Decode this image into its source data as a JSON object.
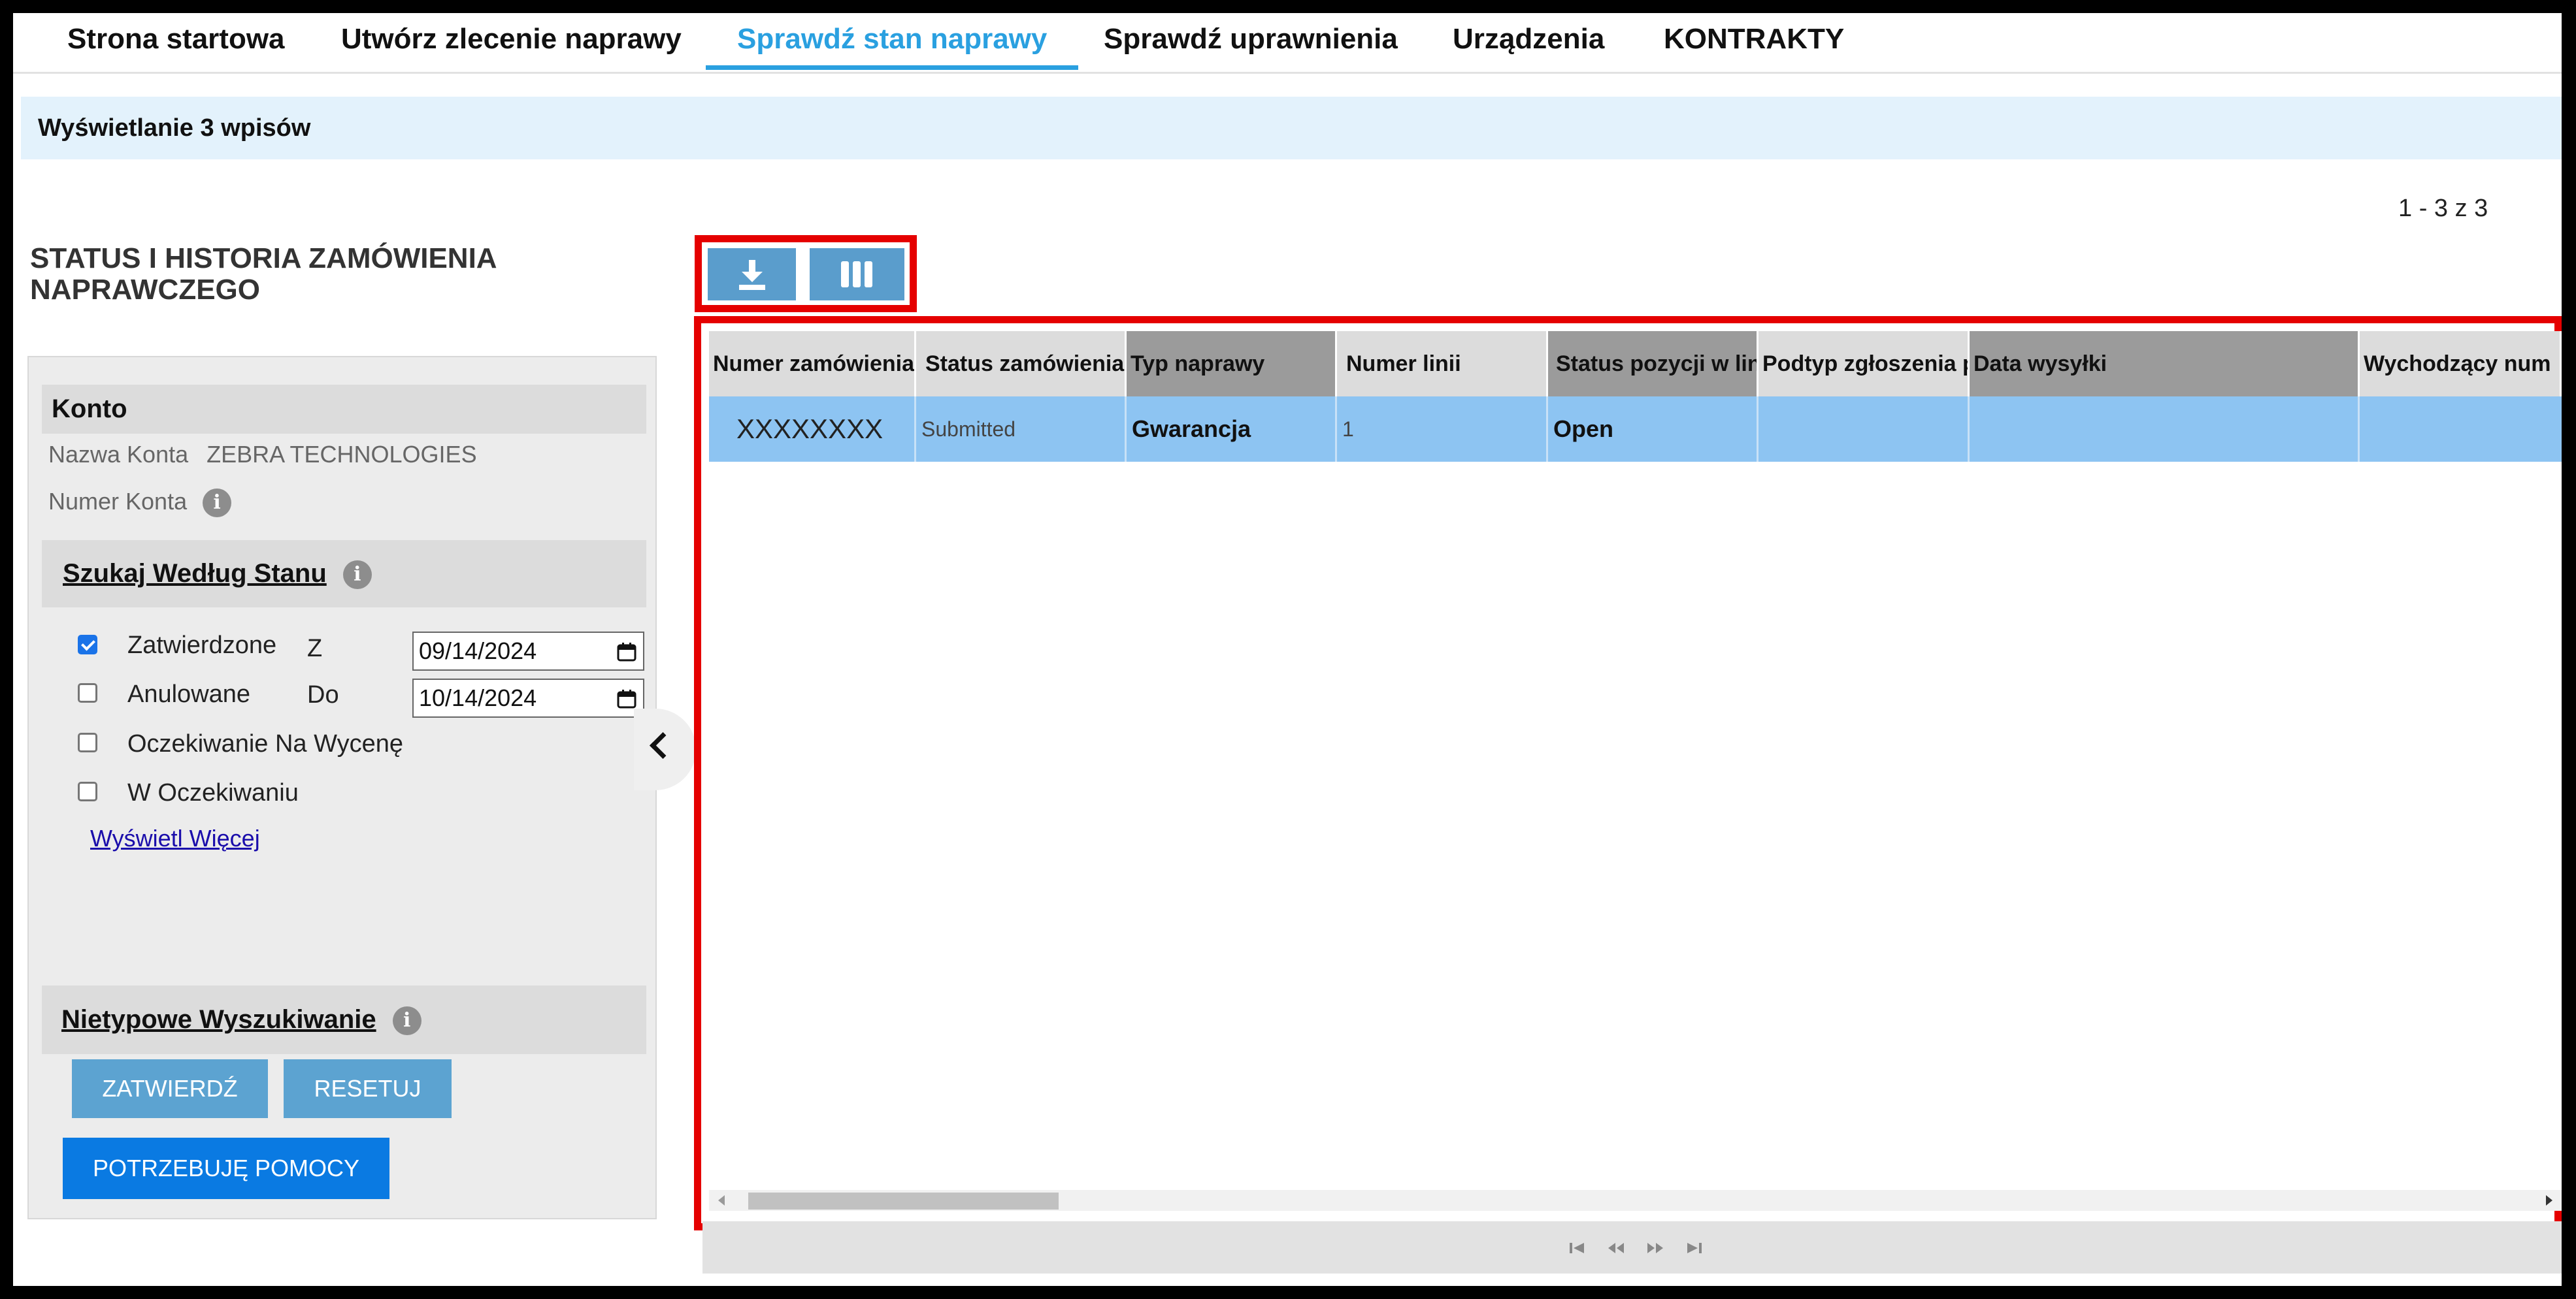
{
  "nav": {
    "items": [
      {
        "label": "Strona startowa",
        "active": false
      },
      {
        "label": "Utwórz zlecenie naprawy",
        "active": false
      },
      {
        "label": "Sprawdź stan naprawy",
        "active": true
      },
      {
        "label": "Sprawdź uprawnienia",
        "active": false
      },
      {
        "label": "Urządzenia",
        "active": false
      },
      {
        "label": "KONTRAKTY",
        "active": false
      }
    ]
  },
  "info_bar": {
    "text": "Wyświetlanie 3 wpisów"
  },
  "page": {
    "title_line1": "STATUS I HISTORIA ZAMÓWIENIA",
    "title_line2": "NAPRAWCZEGO",
    "count_text": "1 - 3 z 3"
  },
  "sidebar": {
    "account_heading": "Konto",
    "account_name_label": "Nazwa Konta",
    "account_name_value": "ZEBRA TECHNOLOGIES",
    "account_number_label": "Numer Konta",
    "info_glyph": "i",
    "status_search_heading": "Szukaj Według Stanu",
    "status_filters": [
      {
        "label": "Zatwierdzone",
        "checked": true
      },
      {
        "label": "Anulowane",
        "checked": false
      },
      {
        "label": "Oczekiwanie Na Wycenę",
        "checked": false
      },
      {
        "label": "W Oczekiwaniu",
        "checked": false
      }
    ],
    "date_from_label": "Z",
    "date_from_value": "09/14/2024",
    "date_to_label": "Do",
    "date_to_value": "10/14/2024",
    "show_more_link": "Wyświetl Więcej",
    "custom_search_heading": "Nietypowe Wyszukiwanie",
    "submit_button": "ZATWIERDŹ",
    "reset_button": "RESETUJ",
    "help_button": "POTRZEBUJĘ POMOCY"
  },
  "toolbar": {
    "download_icon": "download-icon",
    "columns_icon": "columns-icon"
  },
  "grid": {
    "columns": [
      "Numer zamówienia",
      "Status zamówienia",
      "Typ naprawy",
      "Numer linii",
      "Status pozycji w lin",
      "Podtyp zgłoszenia p",
      "Data wysyłki",
      "Wychodzący num"
    ],
    "rows": [
      {
        "order_number": "XXXXXXXX",
        "order_status": "Submitted",
        "repair_type": "Gwarancja",
        "line_number": "1",
        "line_status": "Open",
        "request_subtype": "",
        "ship_date": "",
        "outbound_number": ""
      }
    ]
  },
  "colors": {
    "accent": "#2aa0e0",
    "highlight_frame": "#e50000",
    "row_selected": "#8dc4f2",
    "button": "#5ca3d1",
    "help_button": "#0a7ae2"
  }
}
